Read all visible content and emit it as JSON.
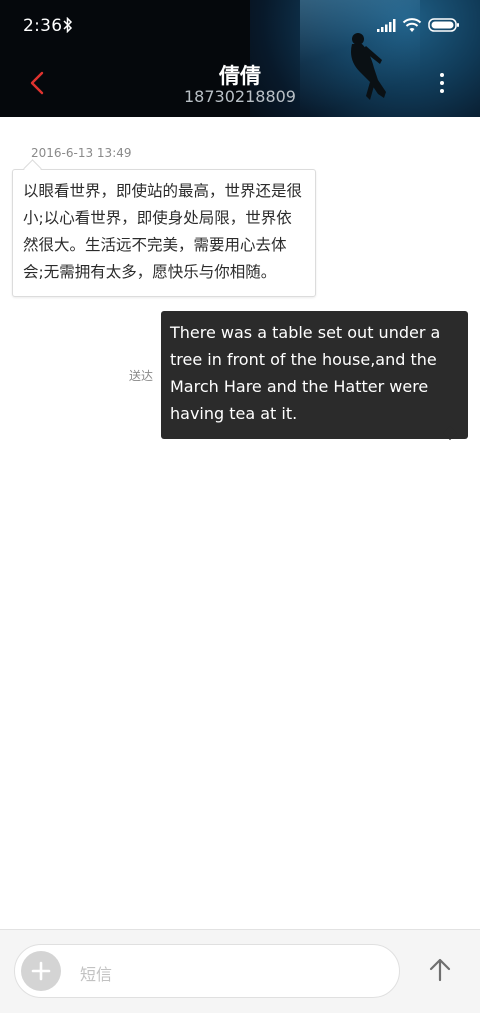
{
  "status_bar": {
    "time": "2:36",
    "icons": [
      "bluetooth-icon",
      "signal-icon",
      "wifi-icon",
      "battery-icon"
    ]
  },
  "header": {
    "contact_name": "倩倩",
    "contact_number": "18730218809",
    "back_icon": "chevron-left-icon",
    "menu_icon": "more-vertical-icon",
    "accent_color": "#e0332f"
  },
  "conversation": {
    "timestamp": "2016-6-13 13:49",
    "incoming_message": "以眼看世界，即使站的最高，世界还是很小;以心看世界，即使身处局限，世界依然很大。生活远不完美，需要用心去体会;无需拥有太多，愿快乐与你相随。",
    "outgoing_message": "There was a table set out under a tree in front of the house,and the March Hare and the Hatter were having tea at it.",
    "delivery_status": "送达"
  },
  "composer": {
    "placeholder": "短信",
    "add_icon": "plus-icon",
    "send_icon": "arrow-up-icon"
  }
}
